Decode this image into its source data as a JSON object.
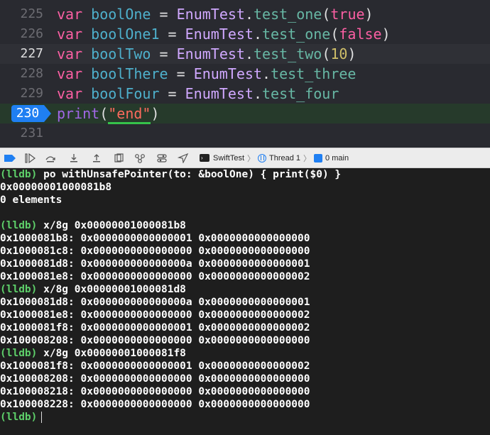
{
  "editor": {
    "lines": [
      {
        "number": "225",
        "tokens": {
          "keyword": "var",
          "name": "boolOne",
          "eq": "=",
          "type": "EnumTest",
          "dot": ".",
          "member": "test_one",
          "open": "(",
          "arg": "true",
          "close": ")"
        }
      },
      {
        "number": "226",
        "tokens": {
          "keyword": "var",
          "name": "boolOne1",
          "eq": "=",
          "type": "EnumTest",
          "dot": ".",
          "member": "test_one",
          "open": "(",
          "arg": "false",
          "close": ")"
        }
      },
      {
        "number": "227",
        "tokens": {
          "keyword": "var",
          "name": "boolTwo",
          "eq": "=",
          "type": "EnumTest",
          "dot": ".",
          "member": "test_two",
          "open": "(",
          "arg": "10",
          "close": ")"
        }
      },
      {
        "number": "228",
        "tokens": {
          "keyword": "var",
          "name": "boolThere",
          "eq": "=",
          "type": "EnumTest",
          "dot": ".",
          "member": "test_three"
        }
      },
      {
        "number": "229",
        "tokens": {
          "keyword": "var",
          "name": "boolFour",
          "eq": "=",
          "type": "EnumTest",
          "dot": ".",
          "member": "test_four"
        }
      },
      {
        "number": "230",
        "tokens": {
          "fn": "print",
          "open": "(",
          "string": "\"end\"",
          "close": ")"
        }
      },
      {
        "number": "231"
      }
    ],
    "colors": {
      "keyword": "#fc5fa3",
      "variable": "#4eb0cc",
      "type": "#d0a8ff",
      "string": "#fc6a5d",
      "number": "#d0bf69",
      "breakpoint": "#1f7ff2"
    }
  },
  "debug_bar": {
    "target": "SwiftTest",
    "thread": "Thread 1",
    "frame": "0 main",
    "icons": [
      "breakpoints-toggle-icon",
      "continue-icon",
      "step-over-icon",
      "step-into-icon",
      "step-out-icon",
      "view-debugger-icon",
      "memory-graph-icon",
      "environment-overrides-icon",
      "simulate-location-icon",
      "terminal-icon",
      "thread-icon",
      "stack-frame-icon"
    ]
  },
  "console": {
    "lines": [
      {
        "prompt": "(lldb)",
        "text": " po withUnsafePointer(to: &boolOne) { print($0) }"
      },
      {
        "text": "0x00000001000081b8"
      },
      {
        "text": "0 elements"
      },
      {
        "text": ""
      },
      {
        "prompt": "(lldb)",
        "text": " x/8g 0x00000001000081b8"
      },
      {
        "text": "0x1000081b8: 0x0000000000000001 0x0000000000000000"
      },
      {
        "text": "0x1000081c8: 0x0000000000000000 0x0000000000000000"
      },
      {
        "text": "0x1000081d8: 0x000000000000000a 0x0000000000000001"
      },
      {
        "text": "0x1000081e8: 0x0000000000000000 0x0000000000000002"
      },
      {
        "prompt": "(lldb)",
        "text": " x/8g 0x00000001000081d8"
      },
      {
        "text": "0x1000081d8: 0x000000000000000a 0x0000000000000001"
      },
      {
        "text": "0x1000081e8: 0x0000000000000000 0x0000000000000002"
      },
      {
        "text": "0x1000081f8: 0x0000000000000001 0x0000000000000002"
      },
      {
        "text": "0x100008208: 0x0000000000000000 0x0000000000000000"
      },
      {
        "prompt": "(lldb)",
        "text": " x/8g 0x00000001000081f8"
      },
      {
        "text": "0x1000081f8: 0x0000000000000001 0x0000000000000002"
      },
      {
        "text": "0x100008208: 0x0000000000000000 0x0000000000000000"
      },
      {
        "text": "0x100008218: 0x0000000000000000 0x0000000000000000"
      },
      {
        "text": "0x100008228: 0x0000000000000000 0x0000000000000000"
      },
      {
        "prompt": "(lldb)",
        "text": ""
      }
    ],
    "prompt_color": "#5ed06a"
  }
}
